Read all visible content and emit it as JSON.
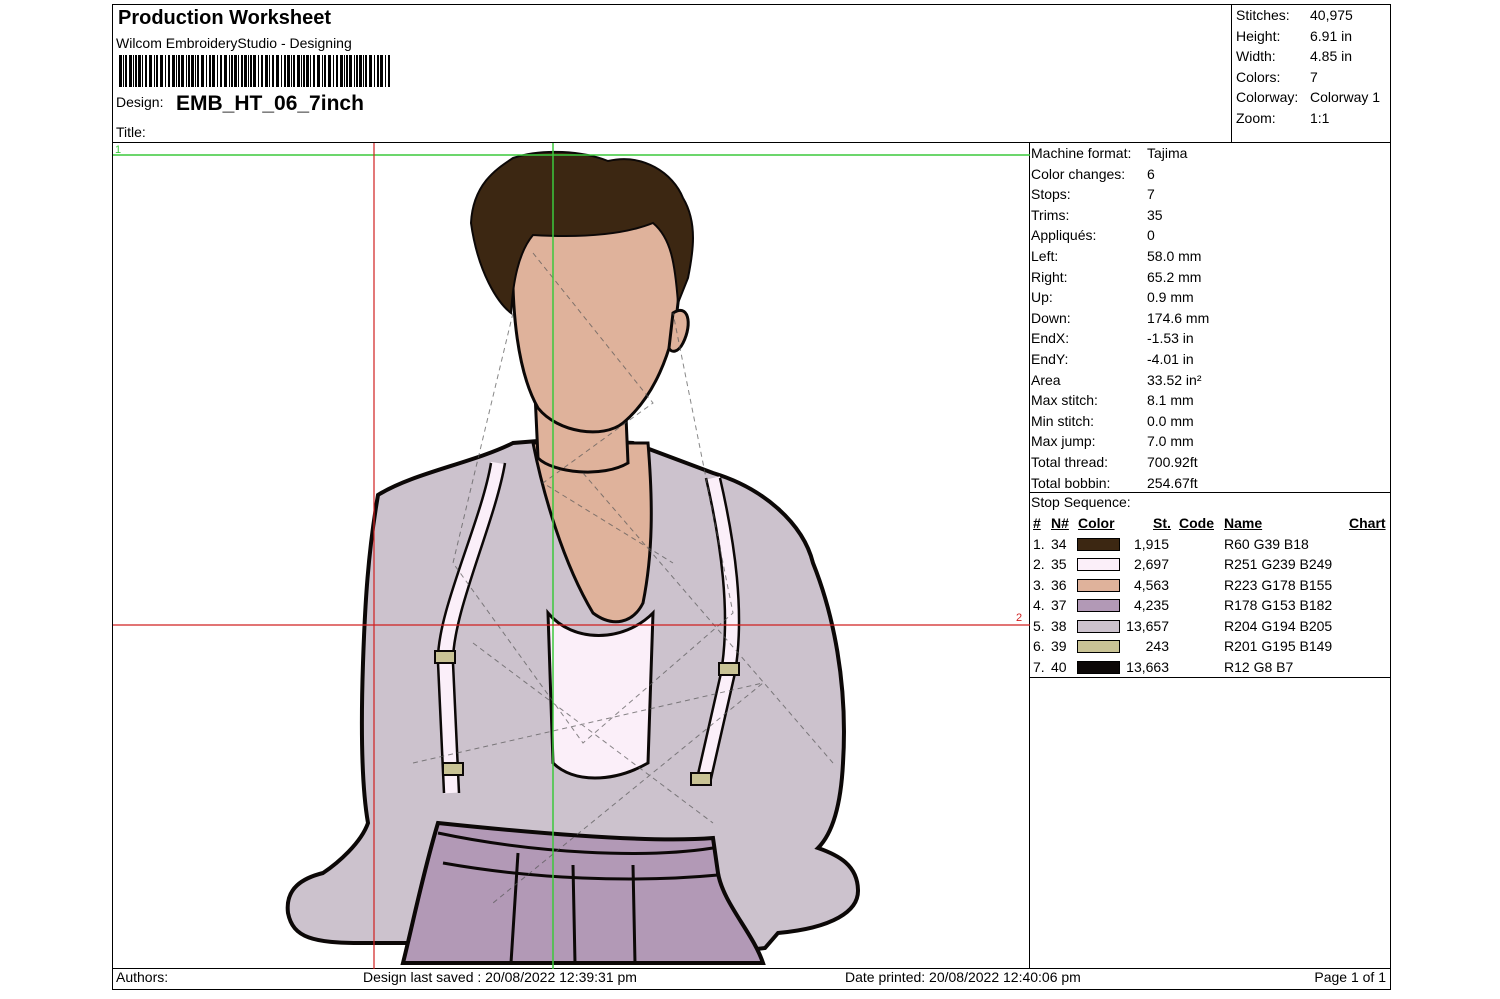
{
  "header": {
    "title": "Production Worksheet",
    "software": "Wilcom EmbroideryStudio - Designing",
    "design_label": "Design:",
    "design_name": "EMB_HT_06_7inch",
    "title_label": "Title:"
  },
  "stats": [
    {
      "label": "Stitches:",
      "value": "40,975"
    },
    {
      "label": "Height:",
      "value": "6.91 in"
    },
    {
      "label": "Width:",
      "value": "4.85 in"
    },
    {
      "label": "Colors:",
      "value": "7"
    },
    {
      "label": "Colorway:",
      "value": "Colorway 1"
    },
    {
      "label": "Zoom:",
      "value": "1:1"
    }
  ],
  "machine": [
    {
      "label": "Machine format:",
      "value": "Tajima"
    },
    {
      "label": "Color changes:",
      "value": "6"
    },
    {
      "label": "Stops:",
      "value": "7"
    },
    {
      "label": "Trims:",
      "value": "35"
    },
    {
      "label": "Appliqués:",
      "value": "0"
    },
    {
      "label": "Left:",
      "value": "58.0 mm"
    },
    {
      "label": "Right:",
      "value": "65.2 mm"
    },
    {
      "label": "Up:",
      "value": "0.9 mm"
    },
    {
      "label": "Down:",
      "value": "174.6 mm"
    },
    {
      "label": "EndX:",
      "value": "-1.53 in"
    },
    {
      "label": "EndY:",
      "value": "-4.01 in"
    },
    {
      "label": "Area",
      "value": " 33.52 in²"
    },
    {
      "label": "Max stitch:",
      "value": "8.1 mm"
    },
    {
      "label": "Min stitch:",
      "value": "0.0 mm"
    },
    {
      "label": "Max jump:",
      "value": "7.0 mm"
    },
    {
      "label": "Total thread:",
      "value": "700.92ft"
    },
    {
      "label": "Total bobbin:",
      "value": "254.67ft"
    }
  ],
  "stop_sequence": {
    "title": "Stop Sequence:",
    "headers": {
      "idx": "#",
      "n": "N#",
      "color": "Color",
      "st": "St.",
      "code": "Code",
      "name": "Name",
      "chart": "Chart"
    },
    "rows": [
      {
        "idx": "1.",
        "n": "34",
        "color": "#3c2712",
        "st": "1,915",
        "name": "R60 G39 B18"
      },
      {
        "idx": "2.",
        "n": "35",
        "color": "#fbeff9",
        "st": "2,697",
        "name": "R251 G239 B249"
      },
      {
        "idx": "3.",
        "n": "36",
        "color": "#dfb29b",
        "st": "4,563",
        "name": "R223 G178 B155"
      },
      {
        "idx": "4.",
        "n": "37",
        "color": "#b299b6",
        "st": "4,235",
        "name": "R178 G153 B182"
      },
      {
        "idx": "5.",
        "n": "38",
        "color": "#ccc2cd",
        "st": "13,657",
        "name": "R204 G194 B205"
      },
      {
        "idx": "6.",
        "n": "39",
        "color": "#c9c395",
        "st": "243",
        "name": "R201 G195 B149"
      },
      {
        "idx": "7.",
        "n": "40",
        "color": "#0c0807",
        "st": "13,663",
        "name": "R12 G8 B7"
      }
    ]
  },
  "footer": {
    "authors": "Authors:",
    "last_saved": "Design last saved : 20/08/2022 12:39:31 pm",
    "printed": "Date printed: 20/08/2022 12:40:06 pm",
    "page": "Page 1 of 1"
  },
  "guides": {
    "marker_1": "1",
    "marker_2": "2"
  },
  "colors": {
    "guide_green": "#3cc83c",
    "guide_red": "#d02020"
  }
}
